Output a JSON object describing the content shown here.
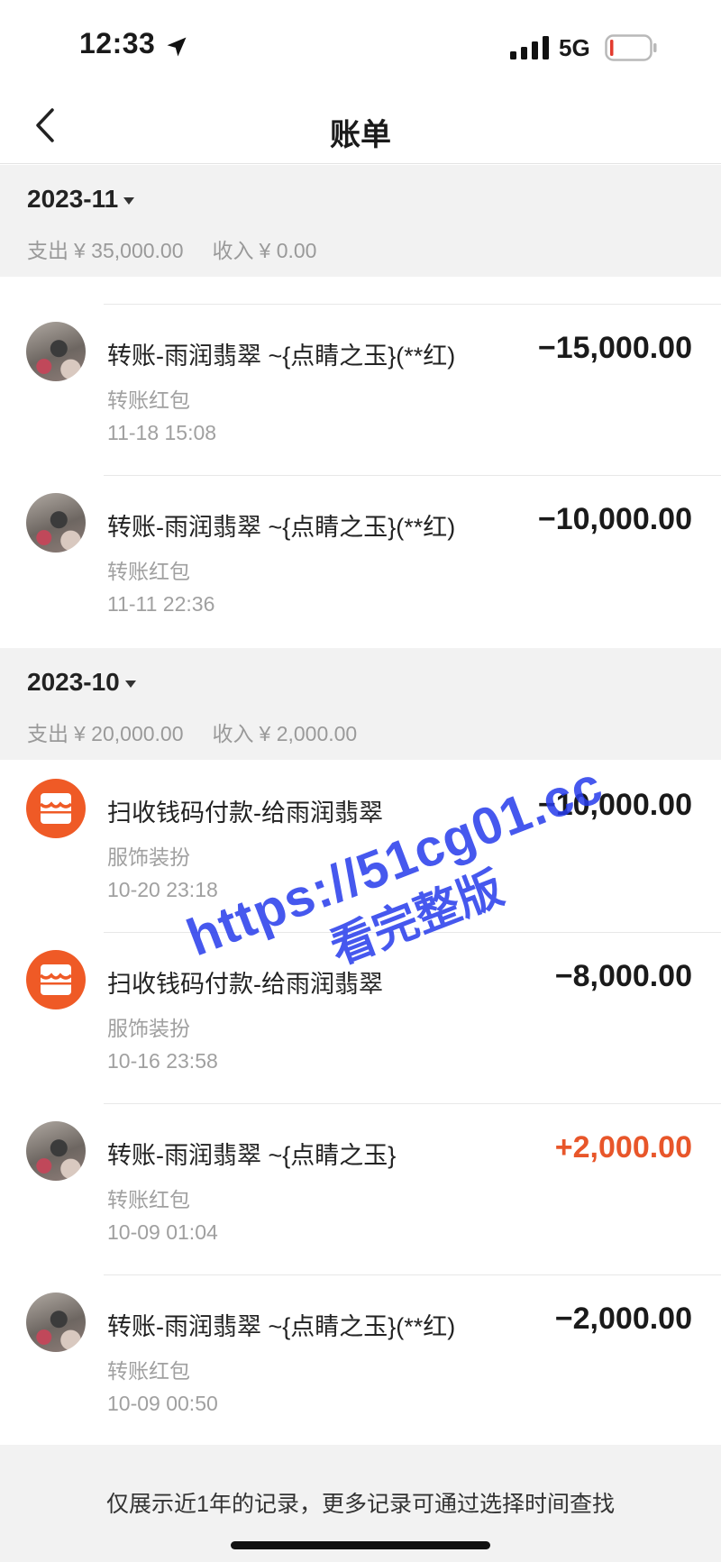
{
  "status": {
    "time": "12:33",
    "network": "5G"
  },
  "nav": {
    "title": "账单"
  },
  "months": [
    {
      "label": "2023-11",
      "expense_label": "支出",
      "expense": "¥ 35,000.00",
      "income_label": "收入",
      "income": "¥ 0.00"
    },
    {
      "label": "2023-10",
      "expense_label": "支出",
      "expense": "¥ 20,000.00",
      "income_label": "收入",
      "income": "¥ 2,000.00"
    }
  ],
  "records": [
    {
      "title": "转账-雨润翡翠 ~{点睛之玉}(**红)",
      "sub": "转账红包",
      "time": "11-18  15:08",
      "amount": "−15,000.00",
      "avatar": "photo"
    },
    {
      "title": "转账-雨润翡翠 ~{点睛之玉}(**红)",
      "sub": "转账红包",
      "time": "11-11  22:36",
      "amount": "−10,000.00",
      "avatar": "photo"
    },
    {
      "title": "扫收钱码付款-给雨润翡翠",
      "sub": "服饰装扮",
      "time": "10-20  23:18",
      "amount": "−10,000.00",
      "avatar": "shop-icon"
    },
    {
      "title": "扫收钱码付款-给雨润翡翠",
      "sub": "服饰装扮",
      "time": "10-16  23:58",
      "amount": "−8,000.00",
      "avatar": "shop-icon"
    },
    {
      "title": "转账-雨润翡翠 ~{点睛之玉}",
      "sub": "转账红包",
      "time": "10-09  01:04",
      "amount": "+2,000.00",
      "avatar": "photo"
    },
    {
      "title": "转账-雨润翡翠 ~{点睛之玉}(**红)",
      "sub": "转账红包",
      "time": "10-09  00:50",
      "amount": "−2,000.00",
      "avatar": "photo"
    }
  ],
  "watermark": {
    "line1": "https://51cg01.cc",
    "line2": "看完整版"
  },
  "footer": {
    "text": "仅展示近1年的记录，更多记录可通过选择时间查找"
  },
  "colors": {
    "accent_orange": "#ef5a26",
    "income_red": "#e8562a",
    "section_bg": "#f2f2f2",
    "watermark_blue": "#283cea"
  }
}
